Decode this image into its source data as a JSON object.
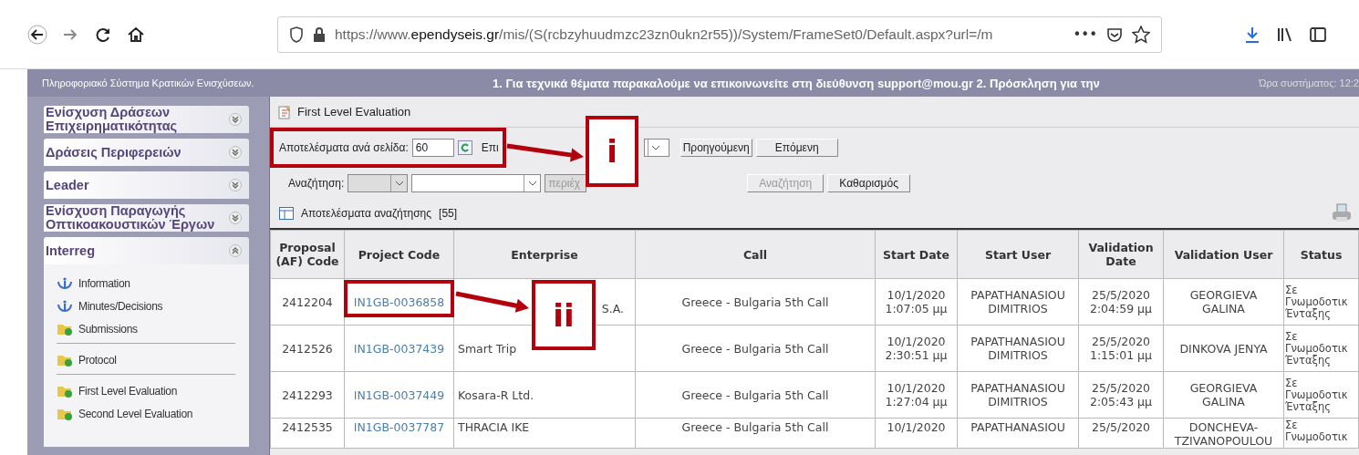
{
  "browser": {
    "url_start": "https://www.",
    "url_domain": "ependyseis.gr",
    "url_end": "/mis/(S(rcbzyhuudmzc23zn0ukn2r55))/System/FrameSet0/Default.aspx?url=/m",
    "more": "•••"
  },
  "header": {
    "title": "Πληροφοριακό Σύστημα Κρατικών Ενισχύσεων.",
    "marquee": "1. Για τεχνικά θέματα παρακαλούμε να επικοινωνείτε στη διεύθυνση support@mou.gr 2. Πρόσκληση για την",
    "clock": "Ώρα συστήματος: 12:2"
  },
  "sidebar": {
    "sections": [
      {
        "title": "Ενίσχυση Δράσεων Επιχειρηματικότητας",
        "expanded": false
      },
      {
        "title": "Δράσεις Περιφερειών",
        "expanded": false
      },
      {
        "title": "Leader",
        "expanded": false
      },
      {
        "title": "Ενίσχυση Παραγωγής Οπτικοακουστικών Έργων",
        "expanded": false
      },
      {
        "title": "Interreg",
        "expanded": true,
        "items": [
          {
            "label": "Information",
            "kind": "info",
            "divider_after": false
          },
          {
            "label": "Minutes/Decisions",
            "kind": "info",
            "divider_after": false
          },
          {
            "label": "Submissions",
            "kind": "folder",
            "divider_after": true
          },
          {
            "label": "Protocol",
            "kind": "folder",
            "divider_after": true
          },
          {
            "label": "First Level Evaluation",
            "kind": "folder",
            "divider_after": false
          },
          {
            "label": "Second Level Evaluation",
            "kind": "folder",
            "divider_after": false
          }
        ]
      }
    ]
  },
  "page": {
    "title": "First Level Evaluation",
    "paging": {
      "label": "Αποτελέσματα ανά σελίδα:",
      "value": "60",
      "page_label": "Επι",
      "prev": "Προηγούμενη",
      "next": "Επόμενη"
    },
    "search": {
      "label": "Αναζήτηση:",
      "operator": "περιέχ",
      "search_button": "Αναζήτηση",
      "clear_button": "Καθαρισμός"
    },
    "results": {
      "label": "Αποτελέσματα αναζήτησης",
      "count": "[55]"
    }
  },
  "table": {
    "columns": [
      "Proposal (AF) Code",
      "Project Code",
      "Enterprise",
      "Call",
      "Start Date",
      "Start User",
      "Validation Date",
      "Validation User",
      "Status"
    ],
    "rows": [
      {
        "cells": [
          "2412204",
          "IN1GB-0036858",
          "S.A.",
          "Greece - Bulgaria 5th Call",
          "10/1/2020 1:07:05 μμ",
          "PAPATHANASIOU DIMITRIOS",
          "25/5/2020 2:04:59 μμ",
          "GEORGIEVA GALINA",
          "Σε Γνωμοδοτικ Ένταξης"
        ]
      },
      {
        "cells": [
          "2412526",
          "IN1GB-0037439",
          "Smart Trip",
          "Greece - Bulgaria 5th Call",
          "10/1/2020 2:30:51 μμ",
          "PAPATHANASIOU DIMITRIOS",
          "25/5/2020 1:15:01 μμ",
          "DINKOVA JENYA",
          "Σε Γνωμοδοτικ Ένταξης"
        ]
      },
      {
        "cells": [
          "2412293",
          "IN1GB-0037449",
          "Kosara-R Ltd.",
          "Greece - Bulgaria 5th Call",
          "10/1/2020 1:27:04 μμ",
          "PAPATHANASIOU DIMITRIOS",
          "25/5/2020 2:05:43 μμ",
          "GEORGIEVA GALINA",
          "Σε Γνωμοδοτικ Ένταξης"
        ]
      },
      {
        "cells": [
          "2412535",
          "IN1GB-0037787",
          "THRACIA IKE",
          "Greece - Bulgaria 5th Call",
          "10/1/2020",
          "PAPATHANASIOU",
          "25/5/2020",
          "DONCHEVA-TZIVANOPOULOU",
          "Σε Γνωμοδοτικ"
        ]
      }
    ]
  },
  "annotations": [
    {
      "label": "i"
    },
    {
      "label": "ii"
    }
  ]
}
